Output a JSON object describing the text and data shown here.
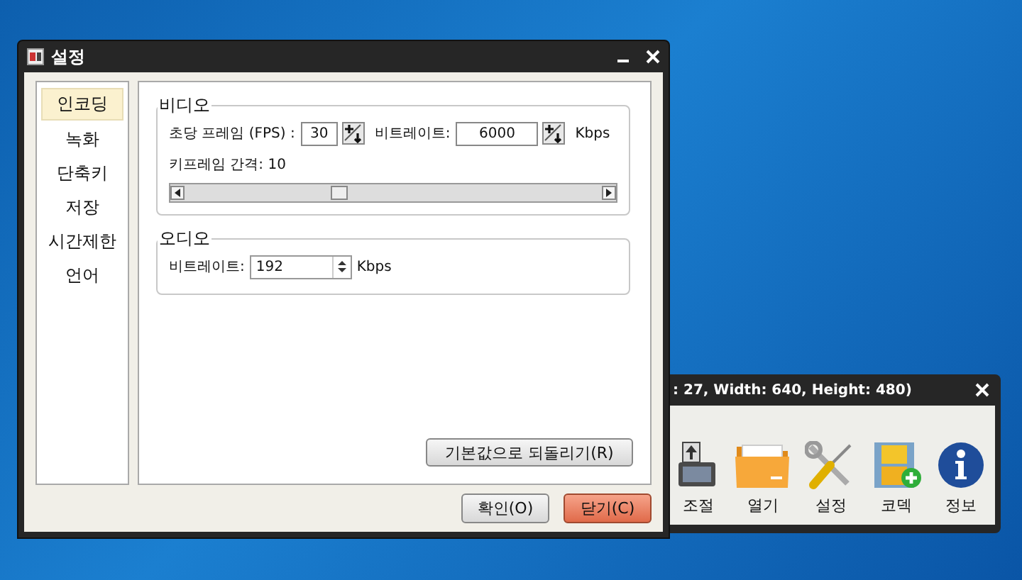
{
  "window": {
    "title": "설정"
  },
  "sidebar": {
    "items": [
      {
        "label": "인코딩",
        "selected": true
      },
      {
        "label": "녹화",
        "selected": false
      },
      {
        "label": "단축키",
        "selected": false
      },
      {
        "label": "저장",
        "selected": false
      },
      {
        "label": "시간제한",
        "selected": false
      },
      {
        "label": "언어",
        "selected": false
      }
    ]
  },
  "video": {
    "title": "비디오",
    "fps_label": "초당 프레임 (FPS) :",
    "fps_value": "30",
    "bitrate_label": "비트레이트:",
    "bitrate_value": "6000",
    "bitrate_unit": "Kbps",
    "keyframe_label": "키프레임 간격: 10",
    "keyframe_slider": {
      "level": 0.37
    }
  },
  "audio": {
    "title": "오디오",
    "bitrate_label": "비트레이트:",
    "bitrate_value": "192",
    "bitrate_unit": "Kbps"
  },
  "reset_button": "기본값으로 되돌리기(R)",
  "buttons": [
    {
      "label": "확인(O)",
      "kind": "normal"
    },
    {
      "label": "닫기(C)",
      "kind": "primary"
    }
  ],
  "background_window": {
    "title": ": 27, Width: 640, Height: 480)",
    "tools": [
      {
        "label": "조절",
        "kind": "resize"
      },
      {
        "label": "열기",
        "kind": "folder"
      },
      {
        "label": "설정",
        "kind": "tools"
      },
      {
        "label": "코덱",
        "kind": "film"
      },
      {
        "label": "정보",
        "kind": "info"
      }
    ]
  }
}
